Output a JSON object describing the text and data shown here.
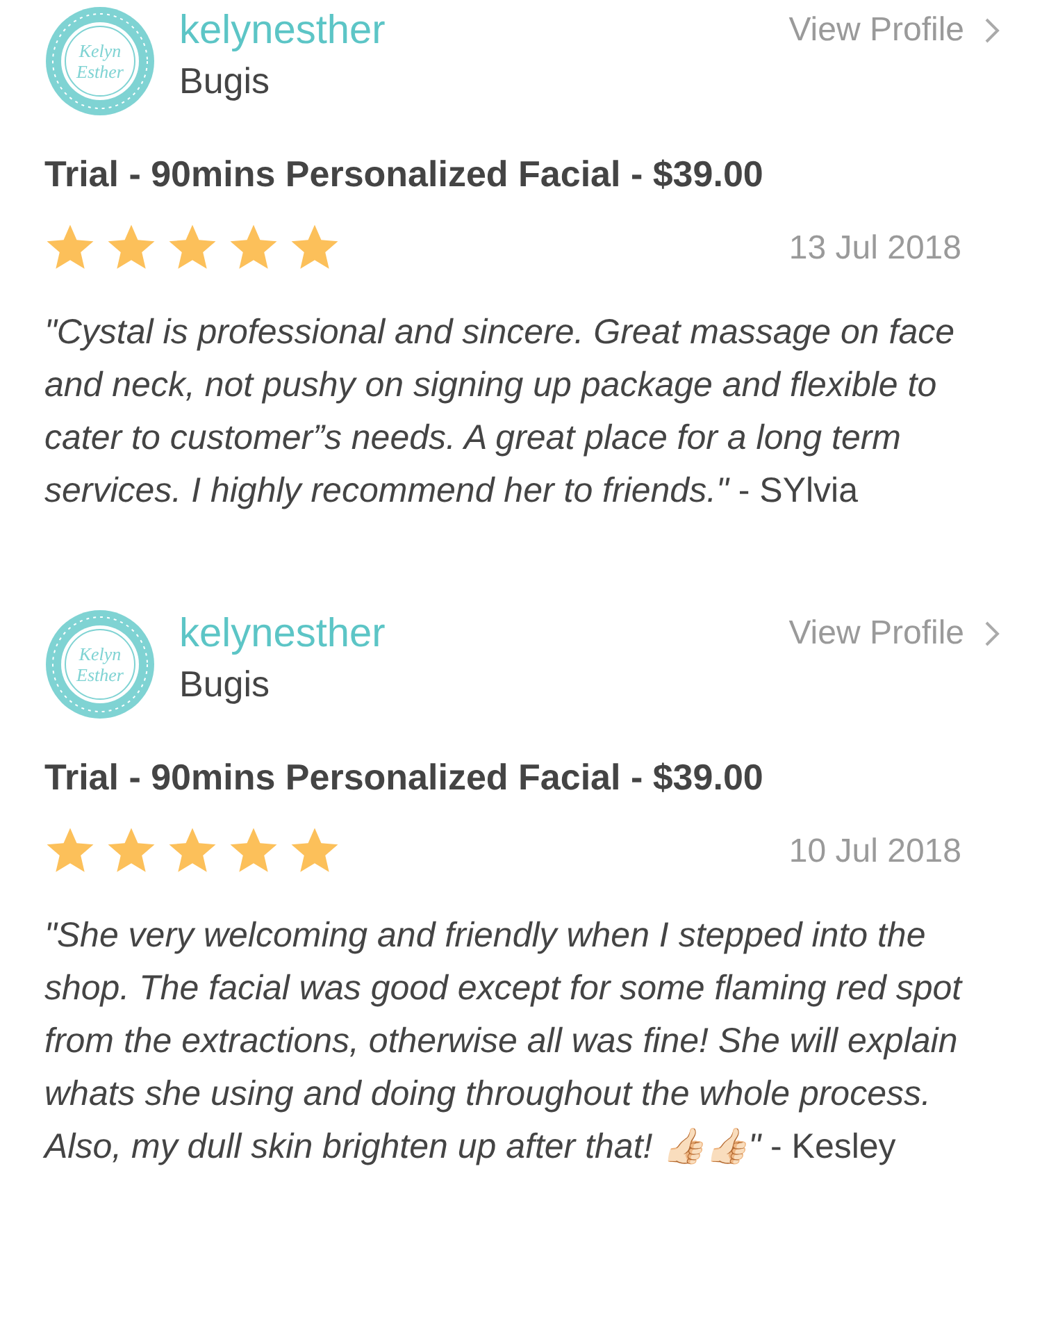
{
  "reviews": [
    {
      "logo": {
        "lines": [
          "Kelyn",
          "Esther"
        ]
      },
      "username": "kelynesther",
      "location": "Bugis",
      "profile_link": "View Profile",
      "title": "Trial - 90mins Personalized Facial - $39.00",
      "stars": 5,
      "date": "13 Jul 2018",
      "text": "*\"Cystal is professional and sincere. Great massage on face and neck, not pushy on signing up package and flexible to cater to customer”s needs. A great place for a long term services. I highly recommend her to friends.\"* - SYlvia"
    },
    {
      "logo": {
        "lines": [
          "Kelyn",
          "Esther"
        ]
      },
      "username": "kelynesther",
      "location": "Bugis",
      "profile_link": "View Profile",
      "title": "Trial - 90mins Personalized Facial - $39.00",
      "stars": 5,
      "date": "10 Jul 2018",
      "text": "*\"She very welcoming and friendly when I stepped into the shop. The facial was good except for some flaming red spot from the extractions, otherwise all was fine! She will explain whats she using and doing throughout the whole process. Also, my dull skin brighten up after that! 👍🏻👍🏻\"* - Kesley"
    }
  ]
}
